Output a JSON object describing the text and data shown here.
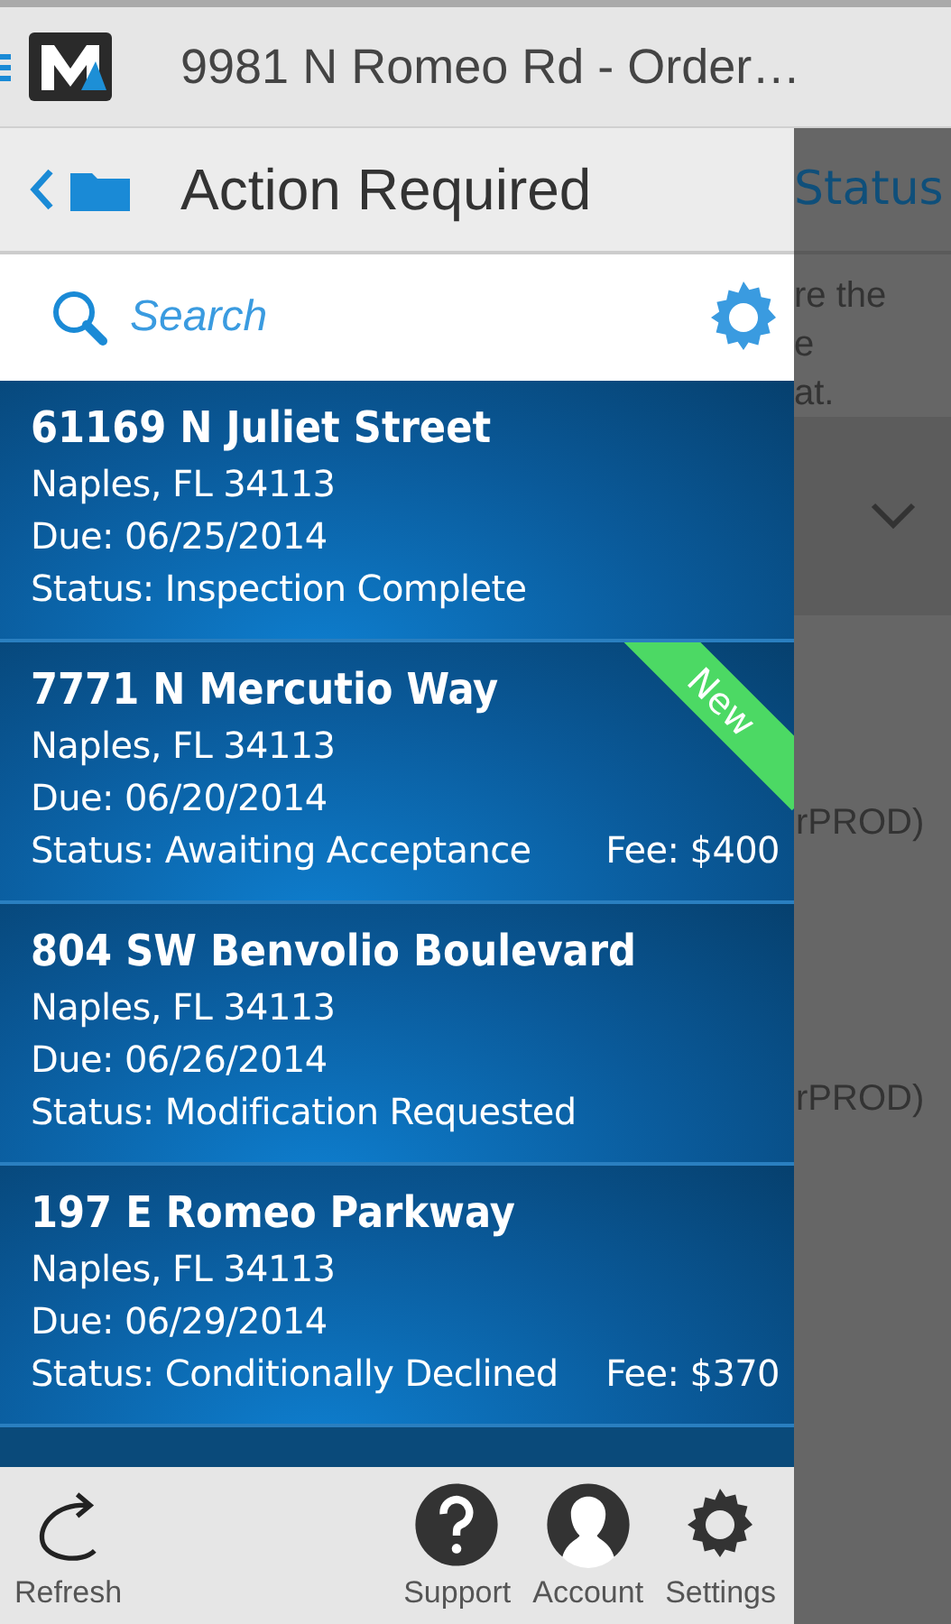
{
  "header": {
    "title": "9981 N Romeo Rd - Order…"
  },
  "drawer": {
    "title": "Action Required",
    "search": {
      "placeholder": "Search"
    },
    "orders": [
      {
        "address": "61169 N Juliet Street",
        "city": "Naples, FL 34113",
        "due": "Due: 06/25/2014",
        "status": "Status: Inspection Complete"
      },
      {
        "address": "7771 N Mercutio Way",
        "city": "Naples, FL 34113",
        "due": "Due: 06/20/2014",
        "status": "Status: Awaiting Acceptance",
        "fee": "Fee: $400",
        "badge": "New"
      },
      {
        "address": "804 SW Benvolio Boulevard",
        "city": "Naples, FL 34113",
        "due": "Due: 06/26/2014",
        "status": "Status: Modification Requested"
      },
      {
        "address": "197 E Romeo Parkway",
        "city": "Naples, FL 34113",
        "due": "Due: 06/29/2014",
        "status": "Status: Conditionally Declined",
        "fee": "Fee: $370"
      }
    ],
    "footer": [
      {
        "kind": "refresh",
        "label": "Refresh"
      },
      {
        "kind": "support",
        "label": "Support"
      },
      {
        "kind": "account",
        "label": "Account"
      },
      {
        "kind": "settings",
        "label": "Settings"
      }
    ]
  },
  "background": {
    "tab": "Status",
    "lines": [
      "re the",
      "e",
      "at."
    ],
    "rows": [
      "rPROD)",
      "rPROD)"
    ]
  }
}
